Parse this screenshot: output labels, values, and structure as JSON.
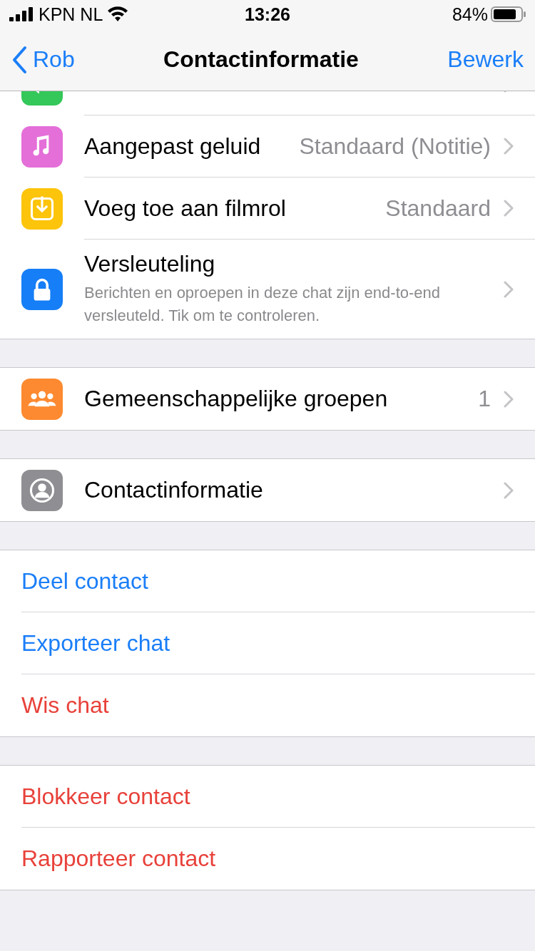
{
  "status_bar": {
    "carrier": "KPN NL",
    "time": "13:26",
    "battery": "84%"
  },
  "nav": {
    "back": "Rob",
    "title": "Contactinformatie",
    "action": "Bewerk"
  },
  "sections": [
    {
      "items": [
        {
          "kind": "setting",
          "color": "#34c759"
        },
        {
          "kind": "setting",
          "color": "#e46fd8",
          "label": "Aangepast geluid",
          "value": "Standaard (Notitie)"
        },
        {
          "kind": "setting",
          "color": "#fcc40a",
          "label": "Voeg toe aan filmrol",
          "value": "Standaard"
        },
        {
          "kind": "setting",
          "color": "#167ef6",
          "label": "Versleuteling",
          "subtitle": "Berichten en oproepen in deze chat zijn end-to-end versleuteld. Tik om te controleren."
        }
      ]
    },
    {
      "items": [
        {
          "kind": "setting",
          "color": "#fd8a30",
          "label": "Gemeenschappelijke groepen",
          "value": "1"
        }
      ]
    },
    {
      "items": [
        {
          "kind": "setting",
          "color": "#8e8e93",
          "label": "Contactinformatie"
        }
      ]
    },
    {
      "items": [
        {
          "kind": "link",
          "label": "Deel contact"
        },
        {
          "kind": "link",
          "label": "Exporteer chat"
        },
        {
          "kind": "destructive",
          "label": "Wis chat"
        }
      ]
    },
    {
      "items": [
        {
          "kind": "destructive",
          "label": "Blokkeer contact"
        },
        {
          "kind": "destructive",
          "label": "Rapporteer contact"
        }
      ]
    }
  ]
}
